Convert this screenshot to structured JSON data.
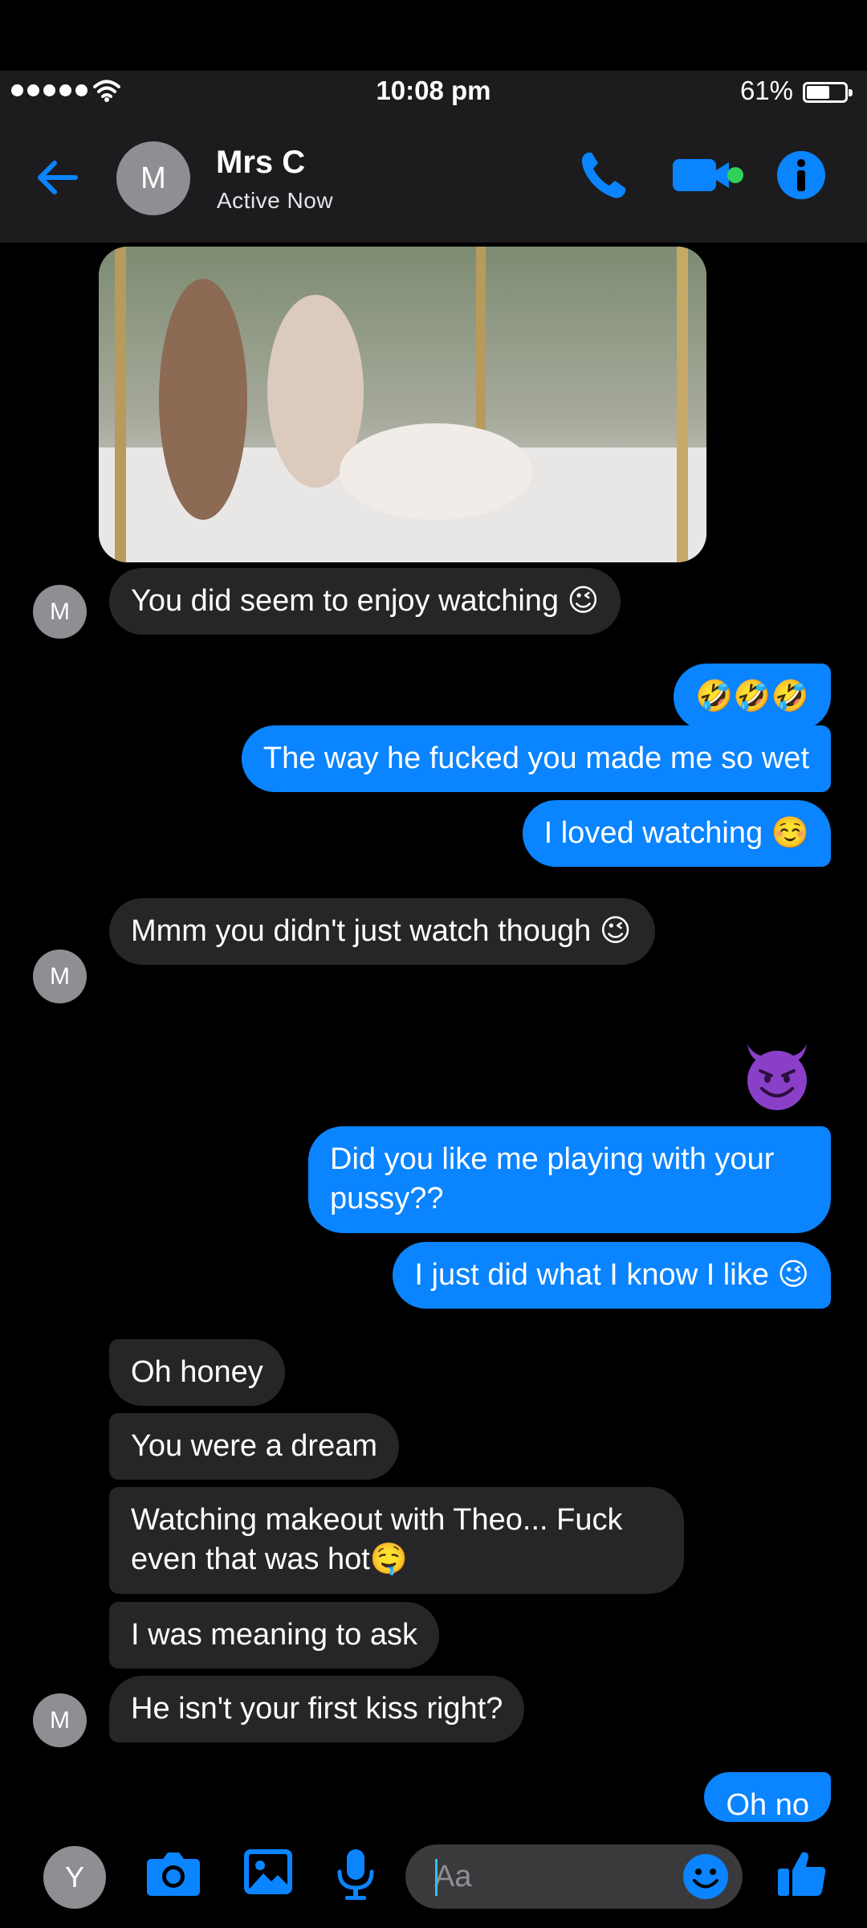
{
  "status_bar": {
    "time": "10:08 pm",
    "battery_percent_label": "61%",
    "battery_level": 0.61
  },
  "header": {
    "avatar_initial": "M",
    "contact_name": "Mrs C",
    "contact_status": "Active Now",
    "accent_color": "#0a84ff",
    "online_color": "#30d158"
  },
  "thread": {
    "incoming_avatar_initial": "M",
    "messages": [
      {
        "from": "them",
        "type": "image",
        "icon": "photo-attachment"
      },
      {
        "from": "them",
        "text": "You did seem to enjoy watching 😉"
      },
      {
        "from": "me",
        "text": "🤣🤣🤣"
      },
      {
        "from": "me",
        "text": "The way he fucked you made me so wet"
      },
      {
        "from": "me",
        "text": "I loved watching ☺️"
      },
      {
        "from": "them",
        "text": "Mmm you didn't just watch though 😉"
      },
      {
        "from": "me",
        "type": "emoji",
        "icon": "smiling-devil-emoji"
      },
      {
        "from": "me",
        "text": "Did you like me playing with your pussy??"
      },
      {
        "from": "me",
        "text": "I just did what I know I like 😉"
      },
      {
        "from": "them",
        "text": "Oh honey"
      },
      {
        "from": "them",
        "text": "You were a dream"
      },
      {
        "from": "them",
        "text": "Watching makeout with Theo... Fuck even that was hot🤤"
      },
      {
        "from": "them",
        "text": "I was meaning to ask"
      },
      {
        "from": "them",
        "text": "He isn't your first kiss right?"
      },
      {
        "from": "me",
        "text": "Oh no"
      }
    ]
  },
  "composer": {
    "my_avatar_initial": "Y",
    "placeholder": "Aa"
  }
}
